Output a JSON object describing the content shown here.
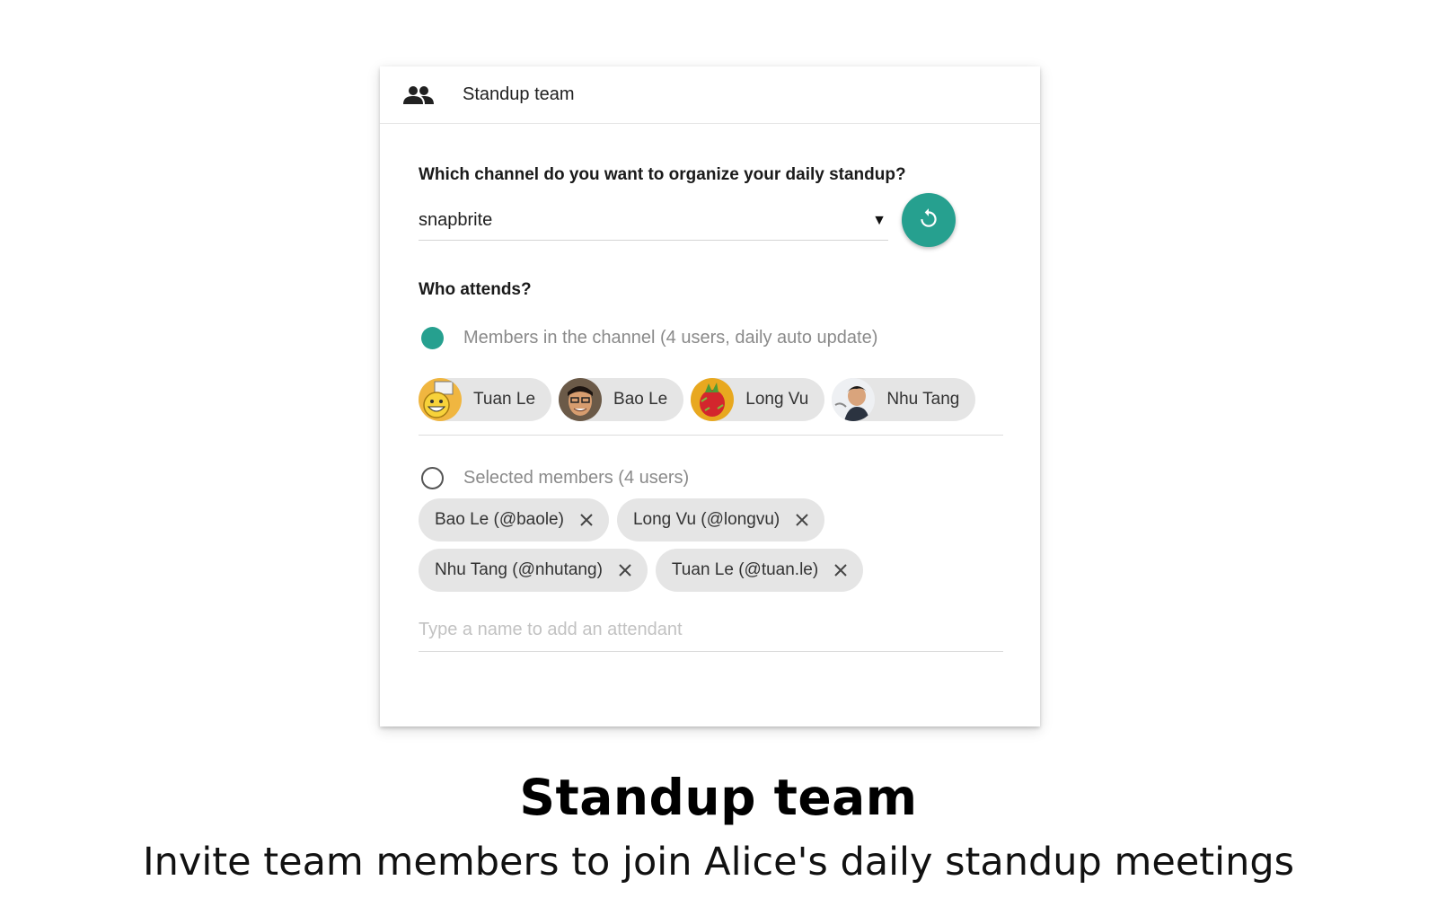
{
  "card": {
    "title": "Standup team",
    "icon": "group-icon"
  },
  "channel": {
    "question": "Which channel do you want to organize your daily standup?",
    "selected": "snapbrite",
    "refresh_icon": "refresh-icon"
  },
  "attendees": {
    "question": "Who attends?",
    "option_channel": {
      "label": "Members in the channel (4 users, daily auto update)",
      "checked": true
    },
    "channel_members": [
      {
        "name": "Tuan Le"
      },
      {
        "name": "Bao Le"
      },
      {
        "name": "Long Vu"
      },
      {
        "name": "Nhu Tang"
      }
    ],
    "option_selected": {
      "label": "Selected members (4 users)",
      "checked": false
    },
    "selected_members": [
      {
        "label": "Bao Le (@baole)"
      },
      {
        "label": "Long Vu (@longvu)"
      },
      {
        "label": "Nhu Tang (@nhutang)"
      },
      {
        "label": "Tuan Le (@tuan.le)"
      }
    ],
    "add_placeholder": "Type a name to add an attendant"
  },
  "caption": {
    "title": "Standup team",
    "subtitle": "Invite team members to join Alice's daily standup meetings"
  },
  "colors": {
    "accent": "#26a08f",
    "chip_bg": "#e5e5e5"
  }
}
